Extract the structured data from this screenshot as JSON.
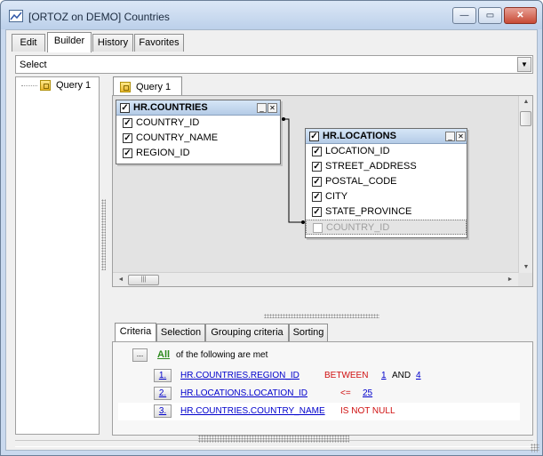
{
  "window": {
    "title": "[ORTOZ on DEMO] Countries",
    "min_glyph": "—",
    "max_glyph": "▭",
    "close_glyph": "✕"
  },
  "main_tabs": [
    {
      "label": "Edit"
    },
    {
      "label": "Builder"
    },
    {
      "label": "History"
    },
    {
      "label": "Favorites"
    }
  ],
  "statement_type": {
    "selected": "Select",
    "dropdown_glyph": "▼"
  },
  "tree": {
    "items": [
      {
        "label": "Query 1"
      }
    ]
  },
  "query_tabs": [
    {
      "label": "Query 1"
    }
  ],
  "diagram": {
    "tables": [
      {
        "name": "HR.COUNTRIES",
        "checked": true,
        "columns": [
          {
            "name": "COUNTRY_ID",
            "checked": true
          },
          {
            "name": "COUNTRY_NAME",
            "checked": true
          },
          {
            "name": "REGION_ID",
            "checked": true
          }
        ]
      },
      {
        "name": "HR.LOCATIONS",
        "checked": true,
        "columns": [
          {
            "name": "LOCATION_ID",
            "checked": true
          },
          {
            "name": "STREET_ADDRESS",
            "checked": true
          },
          {
            "name": "POSTAL_CODE",
            "checked": true
          },
          {
            "name": "CITY",
            "checked": true
          },
          {
            "name": "STATE_PROVINCE",
            "checked": true
          },
          {
            "name": "COUNTRY_ID",
            "checked": false
          }
        ]
      }
    ],
    "join": {
      "from": "HR.COUNTRIES.COUNTRY_ID",
      "to": "HR.LOCATIONS.COUNTRY_ID"
    }
  },
  "bottom_tabs": [
    {
      "label": "Criteria"
    },
    {
      "label": "Selection"
    },
    {
      "label": "Grouping criteria"
    },
    {
      "label": "Sorting"
    }
  ],
  "criteria": {
    "menu_button": "...",
    "quantifier": "All",
    "suffix": "of the following are met",
    "rows": [
      {
        "num": "1.",
        "field": "HR.COUNTRIES.REGION_ID",
        "op": "BETWEEN",
        "v1": "1",
        "and": "AND",
        "v2": "4"
      },
      {
        "num": "2.",
        "field": "HR.LOCATIONS.LOCATION_ID",
        "op": "<=",
        "v1": "25"
      },
      {
        "num": "3.",
        "field": "HR.COUNTRIES.COUNTRY_NAME",
        "op": "IS NOT NULL"
      }
    ]
  },
  "scroll": {
    "up": "▲",
    "down": "▼",
    "left": "◄",
    "right": "►",
    "thumb_grip": "|||"
  },
  "colors": {
    "accent": "#0000cc",
    "operator": "#d01010",
    "all_quantifier": "#2e8b1f"
  }
}
